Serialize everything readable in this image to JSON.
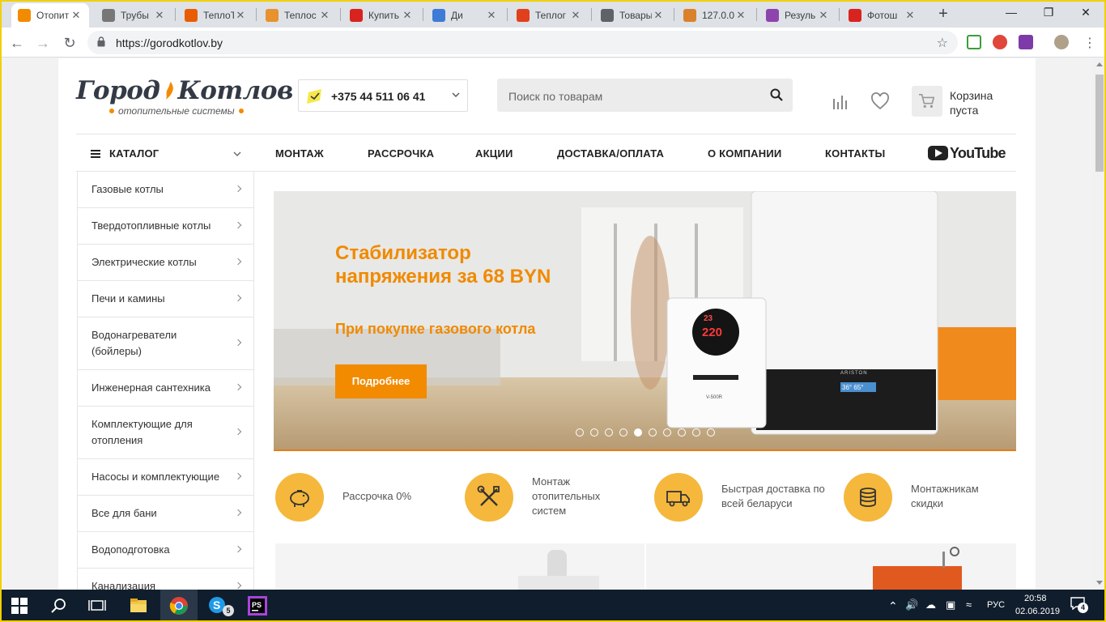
{
  "browser": {
    "tabs": [
      {
        "title": "Отопит",
        "active": true,
        "fav_color": "#f38b00"
      },
      {
        "title": "Трубы",
        "active": false,
        "fav_color": "#777777"
      },
      {
        "title": "ТеплоТ",
        "active": false,
        "fav_color": "#e85d04"
      },
      {
        "title": "Теплос",
        "active": false,
        "fav_color": "#e8912f"
      },
      {
        "title": "Купить",
        "active": false,
        "fav_color": "#d8231f"
      },
      {
        "title": "Ди",
        "active": false,
        "fav_color": "#3d7bd6"
      },
      {
        "title": "Теплог",
        "active": false,
        "fav_color": "#e0401c"
      },
      {
        "title": "Товары",
        "active": false,
        "fav_color": "#5f6368"
      },
      {
        "title": "127.0.0",
        "active": false,
        "fav_color": "#d9822b"
      },
      {
        "title": "Резуль",
        "active": false,
        "fav_color": "#8e44ad"
      },
      {
        "title": "Фотош",
        "active": false,
        "fav_color": "#d8231f"
      }
    ],
    "url": "https://gorodkotlov.by"
  },
  "site": {
    "logo_main_1": "Город",
    "logo_main_2": "Котлов",
    "logo_sub": "отопительные системы",
    "phone": "+375 44 511 06 41",
    "search_placeholder": "Поиск по товарам",
    "cart_line1": "Корзина",
    "cart_line2": "пуста",
    "menu": {
      "catalog": "КАТАЛОГ",
      "items": [
        "МОНТАЖ",
        "РАССРОЧКА",
        "АКЦИИ",
        "ДОСТАВКА/ОПЛАТА",
        "О КОМПАНИИ",
        "КОНТАКТЫ"
      ],
      "youtube": "YouTube"
    },
    "sidebar": [
      "Газовые котлы",
      "Твердотопливные котлы",
      "Электрические котлы",
      "Печи и камины",
      "Водонагреватели (бойлеры)",
      "Инженерная сантехника",
      "Комплектующие для отопления",
      "Насосы и комплектующие",
      "Все для бани",
      "Водоподготовка",
      "Канализация"
    ],
    "banner": {
      "title": "Стабилизатор напряжения за 68 BYN",
      "subtitle": "При покупке газового котла",
      "button": "Подробнее",
      "slides_total": 10,
      "slide_active": 5,
      "display_top": "23",
      "display_main": "220",
      "device_label": "V-500R",
      "boiler_brand": "ARISTON",
      "boiler_display": "36°   65°"
    },
    "features": [
      {
        "icon": "piggy-bank-icon",
        "text": "Рассрочка 0%"
      },
      {
        "icon": "wrench-screwdriver-icon",
        "text": "Монтаж\nотопительных\nсистем"
      },
      {
        "icon": "delivery-truck-icon",
        "text": "Быстрая доставка по\nвсей беларуси"
      },
      {
        "icon": "coins-icon",
        "text": "Монтажникам\nскидки"
      }
    ]
  },
  "taskbar": {
    "time": "20:58",
    "date": "02.06.2019",
    "lang": "РУС",
    "skype_badge": "5",
    "notif_count": "4"
  },
  "colors": {
    "accent": "#f38b00",
    "feature_circle": "#f5b83c",
    "taskbar": "#101d2c"
  }
}
